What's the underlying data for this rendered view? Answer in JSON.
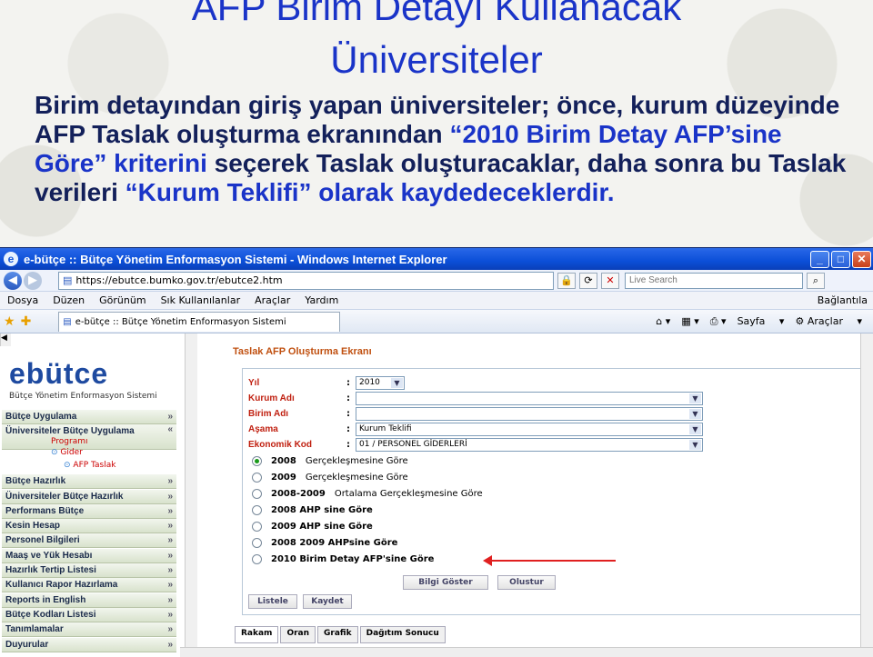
{
  "slide": {
    "title_line1": "AFP Birim Detayı Kullanacak",
    "title_line2": "Üniversiteler",
    "para": {
      "p1": "Birim detayından giriş yapan üniversiteler; önce, kurum düzeyinde AFP Taslak oluşturma ekranından ",
      "p2": "“2010 Birim Detay AFP’sine Göre”",
      "p3": " kriterini ",
      "p4": "seçerek Taslak oluşturacaklar, daha sonra bu Taslak verileri ",
      "p5": "“Kurum Teklifi”",
      "p6": " olarak kaydedeceklerdir."
    }
  },
  "browser": {
    "title": "e-bütçe :: Bütçe Yönetim Enformasyon Sistemi - Windows Internet Explorer",
    "url": "https://ebutce.bumko.gov.tr/ebutce2.htm",
    "search_placeholder": "Live Search",
    "menu": [
      "Dosya",
      "Düzen",
      "Görünüm",
      "Sık Kullanılanlar",
      "Araçlar",
      "Yardım"
    ],
    "links": "Bağlantıla",
    "tab": "e-bütçe :: Bütçe Yönetim Enformasyon Sistemi",
    "tools": {
      "page": "Sayfa",
      "tools": "Araçlar"
    }
  },
  "sidebar": {
    "logo": "ebütce",
    "logo_sub": "Bütçe Yönetim Enformasyon Sistemi",
    "items": [
      "Bütçe Uygulama",
      "Üniversiteler Bütçe Uygulama",
      "Bütçe Hazırlık",
      "Üniversiteler Bütçe Hazırlık",
      "Performans Bütçe",
      "Kesin Hesap",
      "Personel Bilgileri",
      "Maaş ve Yük Hesabı",
      "Hazırlık Tertip Listesi",
      "Kullanıcı Rapor Hazırlama",
      "Reports in English",
      "Bütçe Kodları Listesi",
      "Tanımlamalar",
      "Duyurular"
    ],
    "sub": [
      "Programı",
      "Gider",
      "AFP Taslak"
    ]
  },
  "form": {
    "title": "Taslak AFP Oluşturma Ekranı",
    "fields": [
      {
        "label": "Yıl",
        "value": "2010"
      },
      {
        "label": "Kurum Adı",
        "value": ""
      },
      {
        "label": "Birim Adı",
        "value": ""
      },
      {
        "label": "Aşama",
        "value": "Kurum Teklifi"
      },
      {
        "label": "Ekonomik Kod",
        "value": "01 / PERSONEL GİDERLERİ"
      }
    ],
    "radios": [
      {
        "bold": "2008",
        "text": "Gerçekleşmesine Göre"
      },
      {
        "bold": "2009",
        "text": "Gerçekleşmesine Göre"
      },
      {
        "bold": "2008-2009",
        "text": "Ortalama Gerçekleşmesine Göre"
      },
      {
        "bold": "2008 AHP sine Göre",
        "text": ""
      },
      {
        "bold": "2009  AHP sine Göre",
        "text": ""
      },
      {
        "bold": "2008  2009  AHPsine Göre",
        "text": ""
      },
      {
        "bold": "2010 Birim Detay AFP'sine Göre",
        "text": ""
      }
    ],
    "buttons": {
      "show": "Bilgi Göster",
      "create": "Olustur",
      "list": "Listele",
      "save": "Kaydet"
    },
    "tabs": [
      "Rakam",
      "Oran",
      "Grafik",
      "Dağıtım Sonucu"
    ]
  },
  "colors": {
    "accent": "#1a34c8",
    "title_bar": "#0b4fd8",
    "form_label": "#c02010",
    "arrow": "#e02020"
  }
}
